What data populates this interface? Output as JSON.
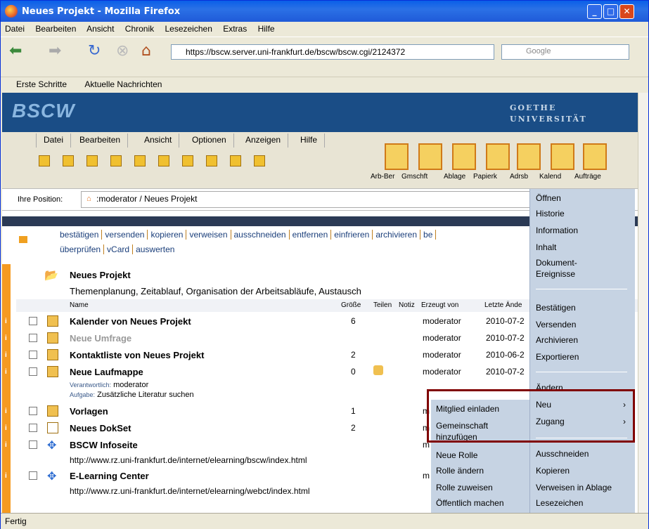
{
  "window": {
    "title": "Neues Projekt - Mozilla Firefox"
  },
  "menu": [
    "Datei",
    "Bearbeiten",
    "Ansicht",
    "Chronik",
    "Lesezeichen",
    "Extras",
    "Hilfe"
  ],
  "url": "https://bscw.server.uni-frankfurt.de/bscw/bscw.cgi/2124372",
  "search_placeholder": "Google",
  "bookmarks": [
    "Erste Schritte",
    "Aktuelle Nachrichten"
  ],
  "bscw": {
    "logo": "BSCW",
    "uni_line1": "GOETHE",
    "uni_line2": "UNIVERSITÄT",
    "menu": [
      "Datei",
      "Bearbeiten",
      "Ansicht",
      "Optionen",
      "Anzeigen",
      "Hilfe"
    ],
    "big_icons": [
      "Arb-Ber",
      "Gmschft",
      "Ablage",
      "Papierk",
      "Adrsb",
      "Kalend",
      "Aufträge"
    ]
  },
  "position": {
    "label": "Ihre Position:",
    "path": ":moderator / Neues Projekt"
  },
  "actions": [
    "bestätigen",
    "versenden",
    "kopieren",
    "verweisen",
    "ausschneiden",
    "entfernen",
    "einfrieren",
    "archivieren",
    "be",
    "überprüfen",
    "vCard",
    "auswerten"
  ],
  "folder": {
    "title": "Neues Projekt",
    "desc": "Themenplanung, Zeitablauf, Organisation der Arbeitsabläufe, Austausch"
  },
  "columns": {
    "name": "Name",
    "size": "Größe",
    "share": "Teilen",
    "note": "Notiz",
    "creator": "Erzeugt von",
    "changed": "Letzte Ände"
  },
  "rows": [
    {
      "name": "Kalender von Neues Projekt",
      "size": "6",
      "creator": "moderator",
      "date": "2010-07-2"
    },
    {
      "name": "Neue Umfrage",
      "size": "",
      "creator": "moderator",
      "date": "2010-07-2"
    },
    {
      "name": "Kontaktliste von Neues Projekt",
      "size": "2",
      "creator": "moderator",
      "date": "2010-06-2"
    },
    {
      "name": "Neue Laufmappe",
      "size": "0",
      "creator": "moderator",
      "date": "2010-07-2",
      "resp_label": "Verantwortlich:",
      "resp": "moderator",
      "task_label": "Aufgabe:",
      "task": "Zusätzliche Literatur suchen"
    },
    {
      "name": "Vorlagen",
      "size": "1",
      "creator": "m",
      "date": ""
    },
    {
      "name": "Neues DokSet",
      "size": "2",
      "creator": "m",
      "date": ""
    },
    {
      "name": "BSCW Infoseite",
      "size": "",
      "creator": "m",
      "date": "",
      "url": "http://www.rz.uni-frankfurt.de/internet/elearning/bscw/index.html"
    },
    {
      "name": "E-Learning Center",
      "size": "",
      "creator": "m",
      "date": "",
      "url": "http://www.rz.uni-frankfurt.de/internet/elearning/webct/index.html"
    }
  ],
  "ctx1": [
    "Öffnen",
    "Historie",
    "Information",
    "Inhalt",
    "Dokument-",
    "Ereignisse",
    "Bestätigen",
    "Versenden",
    "Archivieren",
    "Exportieren",
    "Ändern",
    "Neu",
    "Zugang",
    "Ausschneiden",
    "Kopieren",
    "Verweisen in Ablage",
    "Lesezeichen"
  ],
  "ctx2": [
    "Mitglied einladen",
    "Gemeinschaft",
    "hinzufügen",
    "Neue Rolle",
    "Rolle ändern",
    "Rolle zuweisen",
    "Öffentlich machen"
  ],
  "status": "Fertig"
}
